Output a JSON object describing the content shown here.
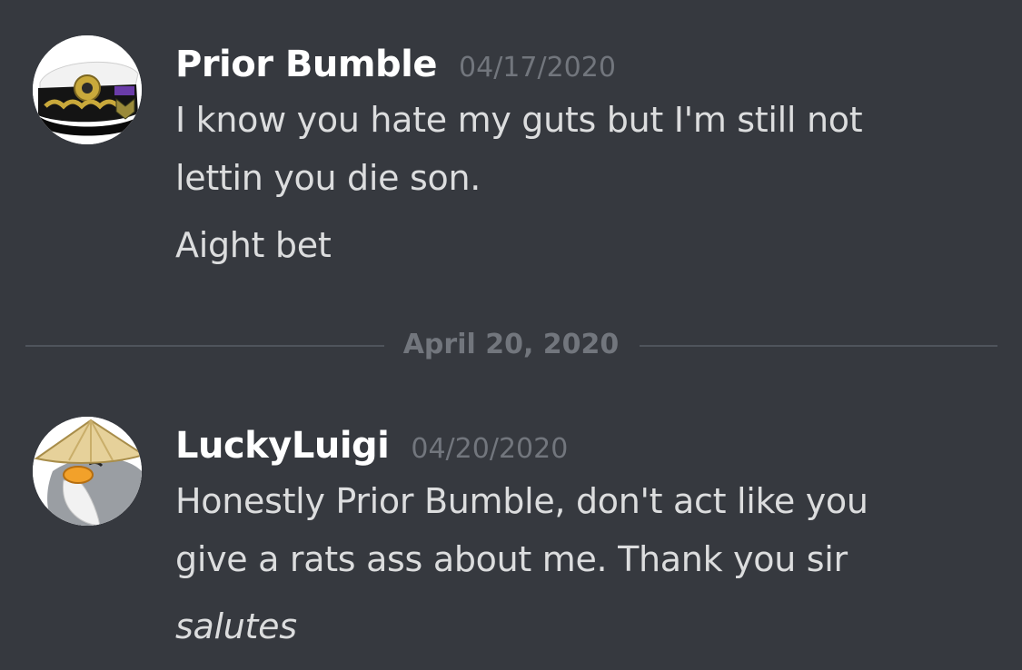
{
  "messages": [
    {
      "username": "Prior Bumble",
      "timestamp": "04/17/2020",
      "avatar_icon": "naval-officer-cap-icon",
      "lines": [
        "I know you hate my guts but I'm still not",
        "lettin you die son.",
        "Aight bet"
      ]
    },
    {
      "username": "LuckyLuigi",
      "timestamp": "04/20/2020",
      "avatar_icon": "penguin-sensei-icon",
      "lines": [
        "Honestly Prior Bumble, don't act like you",
        "give a rats ass about me. Thank you sir",
        "salutes"
      ]
    }
  ],
  "date_divider": {
    "label": "April 20, 2020"
  },
  "colors": {
    "background": "#36393f",
    "username": "#ffffff",
    "message_text": "#dcddde",
    "muted": "#72767d",
    "divider_line": "#4f545c"
  }
}
